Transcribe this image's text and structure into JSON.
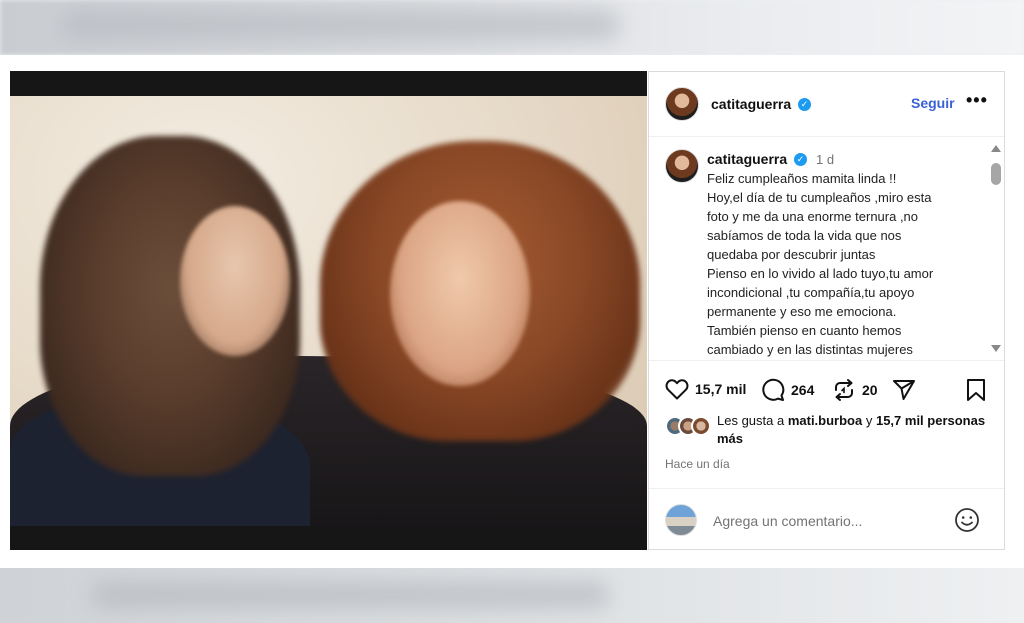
{
  "post": {
    "username": "catitaguerra",
    "follow_label": "Seguir",
    "more_label": "•••",
    "time_label": "1 d",
    "caption_lines": [
      "Feliz cumpleaños mamita linda !!",
      "Hoy,el día de tu cumpleaños ,miro esta",
      "foto y me da una enorme ternura ,no",
      "sabíamos de toda la vida que nos",
      "quedaba por descubrir juntas",
      "Pienso en lo vivido al lado tuyo,tu amor",
      "incondicional ,tu compañía,tu apoyo",
      "permanente y eso me emociona.",
      "También pienso en cuanto hemos",
      "cambiado y en las distintas mujeres"
    ],
    "actions": {
      "likes_count": "15,7 mil",
      "comments_count": "264",
      "reposts_count": "20"
    },
    "likes_text": {
      "prefix": "Les gusta a ",
      "user": "mati.burboa",
      "middle": " y ",
      "count": "15,7 mil",
      "suffix": " personas más"
    },
    "posted_ago": "Hace un día",
    "comment_placeholder": "Agrega un comentario..."
  },
  "colors": {
    "accent": "#3a62d6",
    "verified": "#1d9bf0",
    "muted_text": "#737373"
  },
  "icons": [
    "verified-badge-icon",
    "heart-icon",
    "comment-icon",
    "repost-icon",
    "share-icon",
    "bookmark-icon",
    "emoji-icon",
    "scroll-up-icon",
    "scroll-down-icon"
  ]
}
